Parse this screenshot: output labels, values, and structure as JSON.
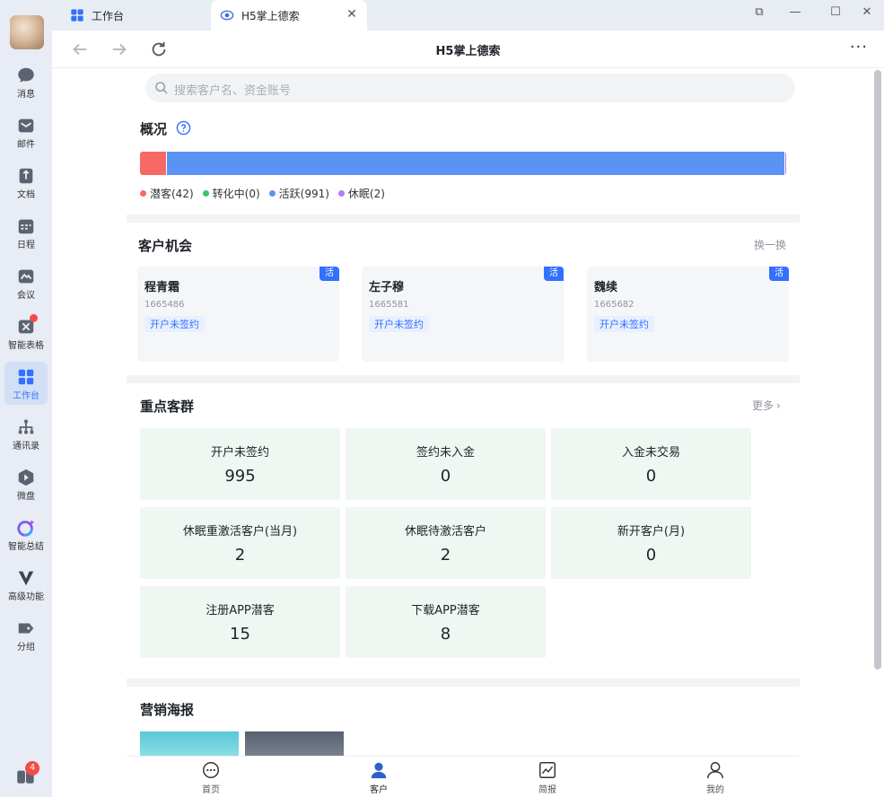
{
  "sidebar": {
    "items": [
      {
        "label": "消息",
        "icon": "chat-bubble-icon"
      },
      {
        "label": "邮件",
        "icon": "mail-icon"
      },
      {
        "label": "文档",
        "icon": "document-icon"
      },
      {
        "label": "日程",
        "icon": "calendar-icon"
      },
      {
        "label": "会议",
        "icon": "meeting-icon"
      },
      {
        "label": "智能表格",
        "icon": "smart-table-icon"
      },
      {
        "label": "工作台",
        "icon": "workbench-grid-icon"
      },
      {
        "label": "通讯录",
        "icon": "contacts-icon"
      },
      {
        "label": "微盘",
        "icon": "drive-icon"
      },
      {
        "label": "智能总结",
        "icon": "ai-summary-icon"
      },
      {
        "label": "高级功能",
        "icon": "advanced-features-icon"
      },
      {
        "label": "分组",
        "icon": "tag-group-icon"
      }
    ],
    "active_index": 6,
    "bottom_badge": "4"
  },
  "tabs": [
    {
      "label": "工作台",
      "icon": "workbench-grid-icon"
    },
    {
      "label": "H5掌上德索",
      "icon": "eye-logo-icon"
    }
  ],
  "toolbar": {
    "title": "H5掌上德索",
    "more": "···"
  },
  "search": {
    "placeholder": "搜索客户名、资金账号"
  },
  "overview": {
    "title": "概况",
    "segments": [
      {
        "label": "潜客(42)",
        "value": 42,
        "color": "#f76964"
      },
      {
        "label": "转化中(0)",
        "value": 0,
        "color": "#35c66b"
      },
      {
        "label": "活跃(991)",
        "value": 991,
        "color": "#5b93f5"
      },
      {
        "label": "休眠(2)",
        "value": 2,
        "color": "#b57bf5"
      }
    ]
  },
  "opportunities": {
    "title": "客户机会",
    "refresh_label": "换一换",
    "cards": [
      {
        "name": "程青霜",
        "account": "1665486",
        "tag": "开户未签约",
        "status": "活"
      },
      {
        "name": "左子穆",
        "account": "1665581",
        "tag": "开户未签约",
        "status": "活"
      },
      {
        "name": "魏续",
        "account": "1665682",
        "tag": "开户未签约",
        "status": "活"
      }
    ]
  },
  "groups": {
    "title": "重点客群",
    "more_label": "更多",
    "cells": [
      {
        "label": "开户未签约",
        "value": "995"
      },
      {
        "label": "签约未入金",
        "value": "0"
      },
      {
        "label": "入金未交易",
        "value": "0"
      },
      {
        "label": "休眠重激活客户(当月)",
        "value": "2"
      },
      {
        "label": "休眠待激活客户",
        "value": "2"
      },
      {
        "label": "新开客户(月)",
        "value": "0"
      },
      {
        "label": "注册APP潜客",
        "value": "15"
      },
      {
        "label": "下载APP潜客",
        "value": "8"
      }
    ]
  },
  "posters": {
    "title": "营销海报"
  },
  "bottom_nav": [
    {
      "label": "首页",
      "icon": "home-chat-icon"
    },
    {
      "label": "客户",
      "icon": "customer-person-icon"
    },
    {
      "label": "简报",
      "icon": "report-chart-icon"
    },
    {
      "label": "我的",
      "icon": "profile-icon"
    }
  ]
}
